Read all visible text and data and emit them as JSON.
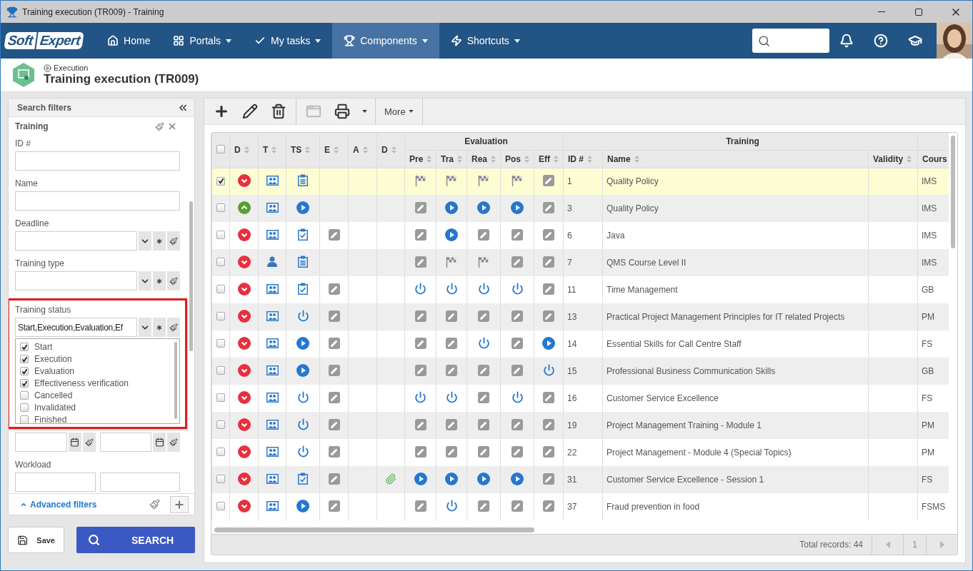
{
  "window": {
    "title": "Training execution (TR009) - Training"
  },
  "nav": {
    "logo": [
      "Soft",
      "Expert"
    ],
    "items": [
      {
        "label": "Home",
        "dropdown": false,
        "selected": false
      },
      {
        "label": "Portals",
        "dropdown": true,
        "selected": false
      },
      {
        "label": "My tasks",
        "dropdown": true,
        "selected": false
      },
      {
        "label": "Components",
        "dropdown": true,
        "selected": true
      },
      {
        "label": "Shortcuts",
        "dropdown": true,
        "selected": false
      }
    ]
  },
  "page": {
    "breadcrumb": "Execution",
    "title": "Training execution (TR009)"
  },
  "filters": {
    "title": "Search filters",
    "section": "Training",
    "fields": [
      {
        "kind": "text",
        "label": "ID #"
      },
      {
        "kind": "text",
        "label": "Name"
      },
      {
        "kind": "select",
        "label": "Deadline"
      },
      {
        "kind": "select",
        "label": "Training type"
      },
      {
        "kind": "select",
        "label": "Training status",
        "value": "Start,Execution,Evaluation,Ef",
        "highlighted": true,
        "options": [
          {
            "label": "Start",
            "checked": true
          },
          {
            "label": "Execution",
            "checked": true
          },
          {
            "label": "Evaluation",
            "checked": true
          },
          {
            "label": "Effectiveness verification",
            "checked": true
          },
          {
            "label": "Cancelled",
            "checked": false
          },
          {
            "label": "Invalidated",
            "checked": false
          },
          {
            "label": "Finished",
            "checked": false
          }
        ]
      },
      {
        "kind": "date_range"
      },
      {
        "kind": "range",
        "label": "Workload"
      }
    ],
    "advanced": "Advanced filters",
    "save": "Save",
    "search": "SEARCH"
  },
  "toolbar": {
    "groups": [
      [
        {
          "kind": "add",
          "disabled": false
        },
        {
          "kind": "edit",
          "disabled": false
        },
        {
          "kind": "delete",
          "disabled": false
        }
      ],
      [
        {
          "kind": "view",
          "disabled": true
        },
        {
          "kind": "print",
          "disabled": false,
          "dropdown": true
        }
      ],
      [
        {
          "kind": "menu",
          "label": "More",
          "dropdown": true
        }
      ]
    ]
  },
  "table": {
    "all_selected": false,
    "columns": [
      {
        "label": "D"
      },
      {
        "label": "T"
      },
      {
        "label": "TS"
      },
      {
        "label": "E"
      },
      {
        "label": "A"
      },
      {
        "label": "D"
      }
    ],
    "groups": [
      {
        "label": "Evaluation",
        "columns": [
          {
            "label": "Pre",
            "sortable": true
          },
          {
            "label": "Tra",
            "sortable": true
          },
          {
            "label": "Rea",
            "sortable": true
          },
          {
            "label": "Pos",
            "sortable": true
          },
          {
            "label": "Eff",
            "sortable": true
          }
        ]
      },
      {
        "label": "Training",
        "columns": [
          {
            "label": "ID #",
            "sortable": true
          },
          {
            "label": "Name",
            "sortable": true
          },
          {
            "label": "Validity",
            "sortable": true
          }
        ]
      },
      {
        "columns": [
          {
            "label": "Cours",
            "sortable": false
          }
        ]
      }
    ],
    "rows": [
      {
        "selected": true,
        "cells": [
          {
            "kind": "down"
          },
          {
            "kind": "group"
          },
          {
            "kind": "list"
          },
          {
            "kind": "empty"
          },
          {
            "kind": "empty"
          },
          {
            "kind": "empty"
          },
          {
            "kind": "flag"
          },
          {
            "kind": "flag"
          },
          {
            "kind": "flag"
          },
          {
            "kind": "flag"
          },
          {
            "kind": "edit"
          }
        ],
        "id": "1",
        "name": "Quality Policy",
        "course": "IMS"
      },
      {
        "selected": false,
        "cells": [
          {
            "kind": "up"
          },
          {
            "kind": "group"
          },
          {
            "kind": "play"
          },
          {
            "kind": "empty"
          },
          {
            "kind": "empty"
          },
          {
            "kind": "empty"
          },
          {
            "kind": "edit"
          },
          {
            "kind": "play"
          },
          {
            "kind": "play"
          },
          {
            "kind": "play"
          },
          {
            "kind": "edit"
          }
        ],
        "id": "3",
        "name": "Quality Policy",
        "course": "IMS"
      },
      {
        "selected": false,
        "cells": [
          {
            "kind": "down"
          },
          {
            "kind": "group"
          },
          {
            "kind": "check"
          },
          {
            "kind": "edit"
          },
          {
            "kind": "empty"
          },
          {
            "kind": "empty"
          },
          {
            "kind": "edit"
          },
          {
            "kind": "play"
          },
          {
            "kind": "edit"
          },
          {
            "kind": "edit"
          },
          {
            "kind": "edit"
          }
        ],
        "id": "6",
        "name": "Java",
        "course": "IMS"
      },
      {
        "selected": false,
        "cells": [
          {
            "kind": "down"
          },
          {
            "kind": "person"
          },
          {
            "kind": "list"
          },
          {
            "kind": "empty"
          },
          {
            "kind": "empty"
          },
          {
            "kind": "empty"
          },
          {
            "kind": "edit"
          },
          {
            "kind": "flag"
          },
          {
            "kind": "flag"
          },
          {
            "kind": "edit"
          },
          {
            "kind": "edit"
          }
        ],
        "id": "7",
        "name": "QMS Course Level II",
        "course": "IMS"
      },
      {
        "selected": false,
        "cells": [
          {
            "kind": "down"
          },
          {
            "kind": "group"
          },
          {
            "kind": "check"
          },
          {
            "kind": "edit"
          },
          {
            "kind": "empty"
          },
          {
            "kind": "empty"
          },
          {
            "kind": "power"
          },
          {
            "kind": "power"
          },
          {
            "kind": "power"
          },
          {
            "kind": "power"
          },
          {
            "kind": "edit"
          }
        ],
        "id": "11",
        "name": "Time Management",
        "course": "GB"
      },
      {
        "selected": false,
        "cells": [
          {
            "kind": "down"
          },
          {
            "kind": "group"
          },
          {
            "kind": "power"
          },
          {
            "kind": "edit"
          },
          {
            "kind": "empty"
          },
          {
            "kind": "empty"
          },
          {
            "kind": "edit"
          },
          {
            "kind": "edit"
          },
          {
            "kind": "edit"
          },
          {
            "kind": "edit"
          },
          {
            "kind": "edit"
          }
        ],
        "id": "13",
        "name": "Practical Project Management Principles for IT related Projects",
        "course": "PM"
      },
      {
        "selected": false,
        "cells": [
          {
            "kind": "down"
          },
          {
            "kind": "group"
          },
          {
            "kind": "play"
          },
          {
            "kind": "edit"
          },
          {
            "kind": "empty"
          },
          {
            "kind": "empty"
          },
          {
            "kind": "edit"
          },
          {
            "kind": "edit"
          },
          {
            "kind": "power"
          },
          {
            "kind": "edit"
          },
          {
            "kind": "play"
          }
        ],
        "id": "14",
        "name": "Essential Skills for Call Centre Staff",
        "course": "FS"
      },
      {
        "selected": false,
        "cells": [
          {
            "kind": "down"
          },
          {
            "kind": "group"
          },
          {
            "kind": "play"
          },
          {
            "kind": "edit"
          },
          {
            "kind": "empty"
          },
          {
            "kind": "empty"
          },
          {
            "kind": "edit"
          },
          {
            "kind": "edit"
          },
          {
            "kind": "edit"
          },
          {
            "kind": "edit"
          },
          {
            "kind": "power"
          }
        ],
        "id": "15",
        "name": "Professional Business Communication Skills",
        "course": "GB"
      },
      {
        "selected": false,
        "cells": [
          {
            "kind": "down"
          },
          {
            "kind": "group"
          },
          {
            "kind": "power"
          },
          {
            "kind": "edit"
          },
          {
            "kind": "empty"
          },
          {
            "kind": "empty"
          },
          {
            "kind": "power"
          },
          {
            "kind": "power"
          },
          {
            "kind": "edit"
          },
          {
            "kind": "power"
          },
          {
            "kind": "edit"
          }
        ],
        "id": "16",
        "name": "Customer Service Excellence",
        "course": "FS"
      },
      {
        "selected": false,
        "cells": [
          {
            "kind": "down"
          },
          {
            "kind": "group"
          },
          {
            "kind": "power"
          },
          {
            "kind": "edit"
          },
          {
            "kind": "empty"
          },
          {
            "kind": "empty"
          },
          {
            "kind": "edit"
          },
          {
            "kind": "edit"
          },
          {
            "kind": "edit"
          },
          {
            "kind": "edit"
          },
          {
            "kind": "edit"
          }
        ],
        "id": "19",
        "name": "Project Management Training - Module 1",
        "course": "PM"
      },
      {
        "selected": false,
        "cells": [
          {
            "kind": "down"
          },
          {
            "kind": "group"
          },
          {
            "kind": "power"
          },
          {
            "kind": "edit"
          },
          {
            "kind": "empty"
          },
          {
            "kind": "empty"
          },
          {
            "kind": "edit"
          },
          {
            "kind": "edit"
          },
          {
            "kind": "edit"
          },
          {
            "kind": "edit"
          },
          {
            "kind": "edit"
          }
        ],
        "id": "22",
        "name": "Project Management - Module 4 (Special Topics)",
        "course": "PM"
      },
      {
        "selected": false,
        "cells": [
          {
            "kind": "down"
          },
          {
            "kind": "group"
          },
          {
            "kind": "check"
          },
          {
            "kind": "edit"
          },
          {
            "kind": "empty"
          },
          {
            "kind": "clip"
          },
          {
            "kind": "play"
          },
          {
            "kind": "play"
          },
          {
            "kind": "play"
          },
          {
            "kind": "play"
          },
          {
            "kind": "edit"
          }
        ],
        "id": "31",
        "name": "Customer Service Excellence - Session 1",
        "course": "FS"
      },
      {
        "selected": false,
        "cells": [
          {
            "kind": "down"
          },
          {
            "kind": "group"
          },
          {
            "kind": "play"
          },
          {
            "kind": "edit"
          },
          {
            "kind": "empty"
          },
          {
            "kind": "empty"
          },
          {
            "kind": "edit"
          },
          {
            "kind": "power"
          },
          {
            "kind": "edit"
          },
          {
            "kind": "edit"
          },
          {
            "kind": "edit"
          }
        ],
        "id": "37",
        "name": "Fraud prevention in food",
        "course": "FSMS"
      }
    ]
  },
  "footer": {
    "total": "Total records: 44",
    "page": "1",
    "prev_disabled": true,
    "next_disabled": true
  }
}
